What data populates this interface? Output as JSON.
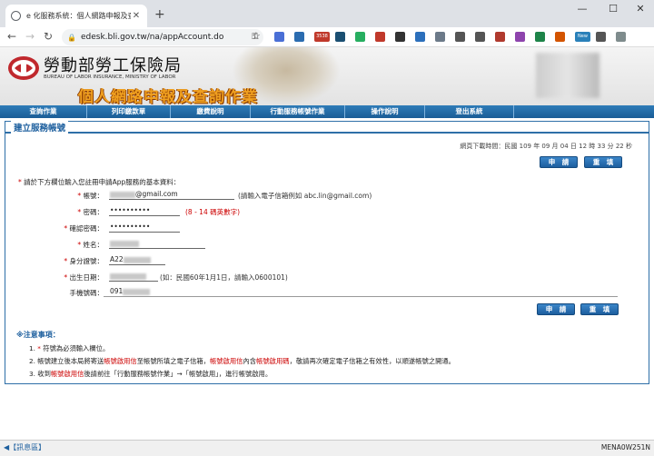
{
  "browser": {
    "tab_title": "e 化服務系統：個人網路申報及查",
    "url": "edesk.bli.gov.tw/na/appAccount.do",
    "extensions": [
      {
        "name": "translate-icon",
        "color": "#4a6fd6"
      },
      {
        "name": "mail-icon",
        "color": "#2b6cb0"
      },
      {
        "name": "badge-3538-icon",
        "color": "#c0392b",
        "label": "3538"
      },
      {
        "name": "download-icon",
        "color": "#1b4f72"
      },
      {
        "name": "evernote-icon",
        "color": "#27ae60"
      },
      {
        "name": "adblock-icon",
        "color": "#c0392b"
      },
      {
        "name": "shield-icon",
        "color": "#333333"
      },
      {
        "name": "camera-icon",
        "color": "#2c6fbb"
      },
      {
        "name": "clip-icon",
        "color": "#6c7a89"
      },
      {
        "name": "circle-icon",
        "color": "#555555"
      },
      {
        "name": "screenshot-icon",
        "color": "#555555"
      },
      {
        "name": "grid-icon",
        "color": "#b03a2e"
      },
      {
        "name": "color-icon",
        "color": "#8e44ad"
      },
      {
        "name": "check-icon",
        "color": "#1e8449"
      },
      {
        "name": "block-icon",
        "color": "#d35400"
      },
      {
        "name": "new-icon",
        "color": "#2980b9",
        "label": "New"
      },
      {
        "name": "puzzle-icon",
        "color": "#555555"
      },
      {
        "name": "profile-icon",
        "color": "#7f8c8d"
      }
    ]
  },
  "header": {
    "site_name": "勞動部勞工保險局",
    "site_name_en": "BUREAU OF LABOR INSURANCE, MINISTRY OF LABOR",
    "banner_title": "個人網路申報及查詢作業"
  },
  "menu": [
    {
      "label": "查詢作業"
    },
    {
      "label": "列印繳款單"
    },
    {
      "label": "繳費說明"
    },
    {
      "label": "行動服務帳號作業"
    },
    {
      "label": "操作說明"
    },
    {
      "label": "登出系統"
    }
  ],
  "panel": {
    "title": "建立服務帳號",
    "timestamp": "網頁下載時間：民國 109 年 09 月 04 日 12 時 33 分 22 秒",
    "submit_label": "申　請",
    "reset_label": "重　填",
    "intro_star": "*",
    "intro": "請於下方欄位輸入您註冊申請App服務的基本資料："
  },
  "form": {
    "email_label": "帳號：",
    "email_value": "@gmail.com",
    "email_hint": "(請輸入電子信箱例如 abc.lin@gmail.com)",
    "password_label": "密碼：",
    "password_value": "••••••••••",
    "password_hint": "(8 - 14 碼英數字)",
    "confirm_label": "確認密碼：",
    "confirm_value": "••••••••••",
    "name_label": "姓名：",
    "id_label": "身分證號：",
    "id_value": "A22",
    "birth_label": "出生日期：",
    "birth_hint": "(如：民國60年1月1日，請輸入0600101)",
    "phone_label": "手機號碼：",
    "phone_value": "091",
    "star": "*"
  },
  "notes": {
    "title": "※注意事項：",
    "items": [
      {
        "a": "1. ",
        "r1": "*",
        "b": " 符號為必須輸入欄位。",
        "r2": "",
        "c": "",
        "r3": "",
        "d": ""
      },
      {
        "a": "2. 帳號建立後本局將寄送",
        "r1": "帳號啟用信",
        "b": "至帳號所填之電子信箱，",
        "r2": "帳號啟用信",
        "c": "內含",
        "r3": "帳號啟用碼",
        "d": "，敬請再次確定電子信箱之有效性，以順遂帳號之開通。"
      },
      {
        "a": "3. 收到",
        "r1": "帳號啟用信",
        "b": "後請前往「行動服務帳號作業」→「帳號啟用」，進行帳號啟用。",
        "r2": "",
        "c": "",
        "r3": "",
        "d": ""
      }
    ]
  },
  "status": {
    "left": "◀【訊息區】",
    "right": "MENA0W251N"
  }
}
